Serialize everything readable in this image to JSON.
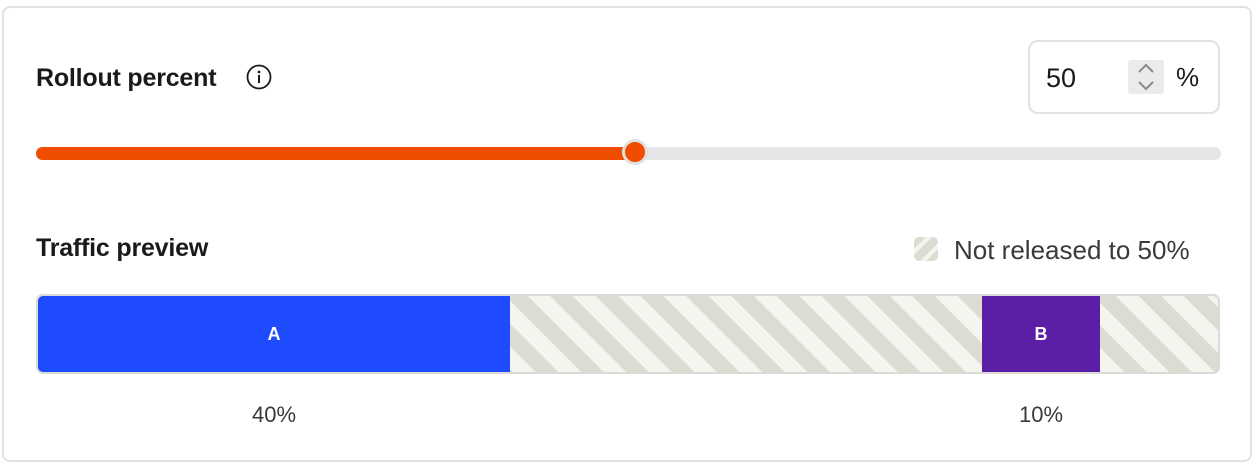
{
  "rollout": {
    "label": "Rollout percent",
    "value": "50",
    "unit": "%",
    "slider_fraction": 0.5,
    "accent_color": "#f04d00"
  },
  "traffic": {
    "label": "Traffic preview",
    "legend_text": "Not released to 50%",
    "segments": [
      {
        "label": "A",
        "percent": 40,
        "percent_text": "40%",
        "color": "#1f4bff"
      },
      {
        "label": "",
        "percent": 40,
        "percent_text": "",
        "color": "unreleased"
      },
      {
        "label": "B",
        "percent": 10,
        "percent_text": "10%",
        "color": "#5b1ea6"
      },
      {
        "label": "",
        "percent": 10,
        "percent_text": "",
        "color": "unreleased"
      }
    ]
  },
  "icons": {
    "info": "info-icon",
    "stepper": "chevron-up-down-icon",
    "legend": "striped-swatch-icon"
  }
}
